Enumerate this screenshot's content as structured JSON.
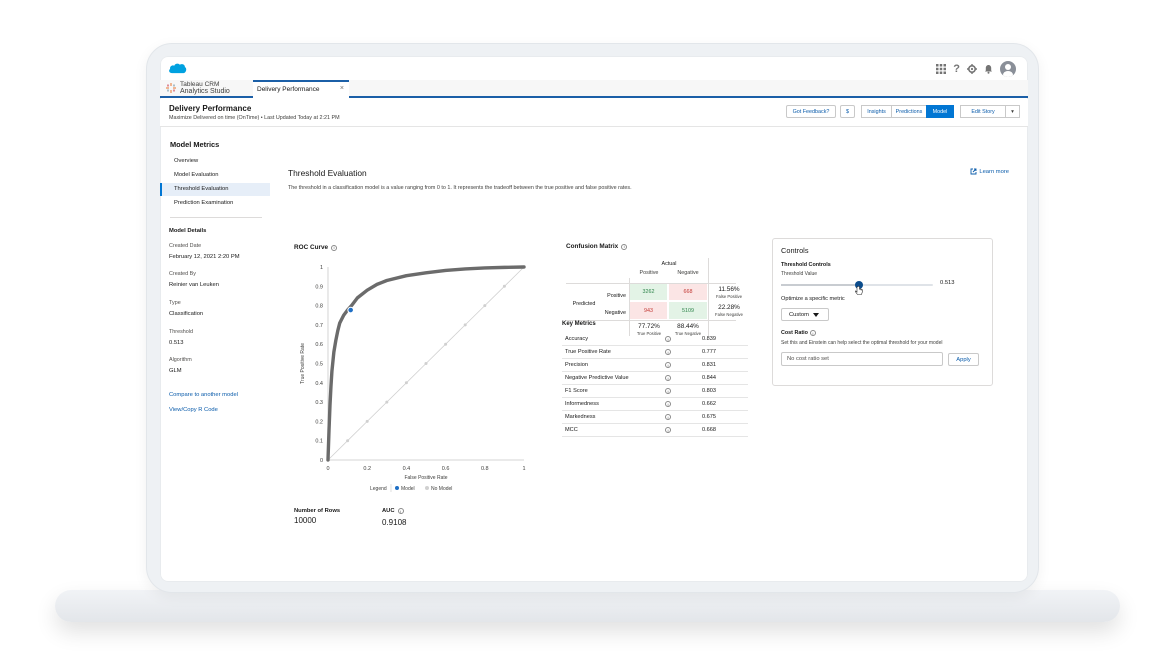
{
  "topbar": {
    "icons": [
      "app-launcher-icon",
      "help-icon",
      "gear-icon",
      "bell-icon",
      "avatar"
    ]
  },
  "tabs": {
    "app_name_line1": "Tableau CRM",
    "app_name_line2": "Analytics Studio",
    "active_tab": "Delivery Performance",
    "close": "×"
  },
  "header": {
    "title": "Delivery Performance",
    "subtitle": "Maximize Delivered on time (OnTime) • Last Updated Today at 2:21 PM",
    "feedback": "Got Feedback?",
    "dollar": "$",
    "insights": "Insights",
    "predictions": "Predictions",
    "model": "Model",
    "edit_story": "Edit Story",
    "caret": "▾"
  },
  "sidebar": {
    "heading": "Model Metrics",
    "items": [
      "Overview",
      "Model Evaluation",
      "Threshold Evaluation",
      "Prediction Examination"
    ],
    "details_heading": "Model Details",
    "created_date_label": "Created Date",
    "created_date": "February 12, 2021 2:20 PM",
    "created_by_label": "Created By",
    "created_by": "Reinier van Leuken",
    "type_label": "Type",
    "type": "Classification",
    "threshold_label": "Threshold",
    "threshold": "0.513",
    "algorithm_label": "Algorithm",
    "algorithm": "GLM",
    "compare_link": "Compare to another model",
    "view_code_link": "View/Copy R Code"
  },
  "main": {
    "title": "Threshold Evaluation",
    "description": "The threshold in a classification model is a value ranging from 0 to 1. It represents the tradeoff between the true positive and false positive rates.",
    "learn_more": "Learn more"
  },
  "roc": {
    "title": "ROC Curve",
    "legend_label": "Legend",
    "legend_model": "Model",
    "legend_no_model": "No Model"
  },
  "chart_data": {
    "type": "line",
    "title": "ROC Curve",
    "xlabel": "False Positive Rate",
    "ylabel": "True Positive Rate",
    "xlim": [
      0,
      1
    ],
    "ylim": [
      0,
      1
    ],
    "x_ticks": [
      "0",
      "0.2",
      "0.4",
      "0.6",
      "0.8",
      "1"
    ],
    "y_ticks": [
      "0",
      "0.1",
      "0.2",
      "0.3",
      "0.4",
      "0.5",
      "0.6",
      "0.7",
      "0.8",
      "0.9",
      "1"
    ],
    "series": [
      {
        "name": "Model",
        "color": "#6b6b6b",
        "x": [
          0,
          0.005,
          0.01,
          0.015,
          0.02,
          0.03,
          0.04,
          0.05,
          0.06,
          0.08,
          0.1,
          0.12,
          0.15,
          0.2,
          0.25,
          0.3,
          0.4,
          0.5,
          0.6,
          0.7,
          0.8,
          0.9,
          1.0
        ],
        "y": [
          0,
          0.15,
          0.28,
          0.38,
          0.46,
          0.56,
          0.62,
          0.67,
          0.71,
          0.75,
          0.777,
          0.8,
          0.84,
          0.88,
          0.91,
          0.93,
          0.955,
          0.97,
          0.982,
          0.99,
          0.995,
          0.998,
          1.0
        ]
      },
      {
        "name": "No Model",
        "color": "#d0d0d0",
        "x": [
          0,
          0.1,
          0.2,
          0.3,
          0.4,
          0.5,
          0.6,
          0.7,
          0.8,
          0.9,
          1
        ],
        "y": [
          0,
          0.1,
          0.2,
          0.3,
          0.4,
          0.5,
          0.6,
          0.7,
          0.8,
          0.9,
          1
        ]
      }
    ],
    "highlight_point": {
      "x": 0.1156,
      "y": 0.777,
      "color": "#1f6fc5"
    },
    "grid": false,
    "legend_position": "bottom"
  },
  "confusion_matrix": {
    "title": "Confusion Matrix",
    "actual_label": "Actual",
    "col_positive": "Positive",
    "col_negative": "Negative",
    "predicted_label": "Predicted",
    "row_positive": "Positive",
    "row_negative": "Negative",
    "tp": "3262",
    "fp": "668",
    "fn": "943",
    "tn": "5109",
    "false_positive_pct": "11.56%",
    "false_positive_label": "False Positive",
    "false_negative_pct": "22.28%",
    "false_negative_label": "False Negative",
    "true_positive_pct": "77.72%",
    "true_positive_label": "True Positive",
    "true_negative_pct": "88.44%",
    "true_negative_label": "True Negative",
    "colors": {
      "good": "#e3f3e6",
      "bad": "#fbe5e5",
      "good_text": "#2e844a",
      "bad_text": "#c23934"
    }
  },
  "key_metrics": {
    "title": "Key Metrics",
    "rows": [
      {
        "label": "Accuracy",
        "value": "0.839"
      },
      {
        "label": "True Positive Rate",
        "value": "0.777"
      },
      {
        "label": "Precision",
        "value": "0.831"
      },
      {
        "label": "Negative Predictive Value",
        "value": "0.844"
      },
      {
        "label": "F1 Score",
        "value": "0.803"
      },
      {
        "label": "Informedness",
        "value": "0.662"
      },
      {
        "label": "Markedness",
        "value": "0.675"
      },
      {
        "label": "MCC",
        "value": "0.668"
      }
    ]
  },
  "controls": {
    "title": "Controls",
    "threshold_controls": "Threshold Controls",
    "threshold_value_label": "Threshold Value",
    "threshold_value": "0.513",
    "slider_fraction": 0.513,
    "optimize_label": "Optimize a specific metric",
    "optimize_value": "Custom",
    "cost_ratio_label": "Cost Ratio",
    "cost_ratio_help": "Set this and Einstein can help select the optimal threshold for your model",
    "cost_ratio_placeholder": "No cost ratio set",
    "apply": "Apply"
  },
  "footer": {
    "rows_label": "Number of Rows",
    "rows_value": "10000",
    "auc_label": "AUC",
    "auc_value": "0.9108"
  }
}
